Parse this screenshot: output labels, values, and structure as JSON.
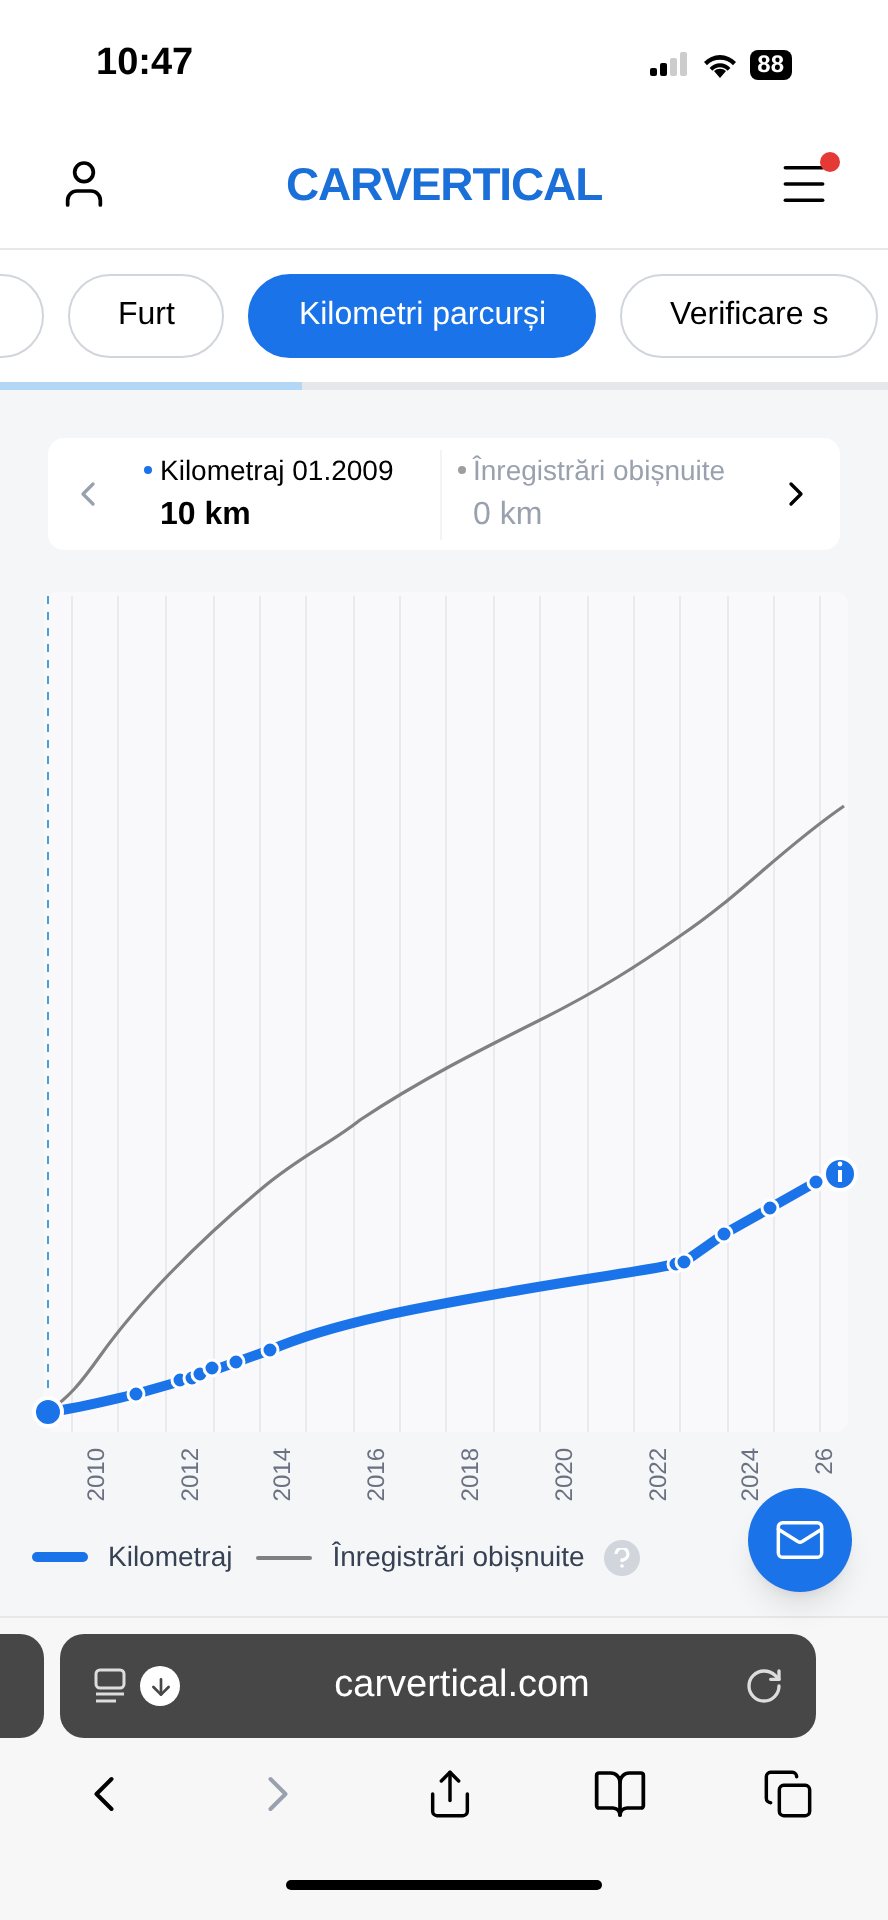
{
  "status_bar": {
    "time": "10:47",
    "battery": "88"
  },
  "header": {
    "logo": "CARVERTICAL",
    "notification": true
  },
  "tabs": [
    {
      "selected": false
    },
    {
      "label": "Furt",
      "selected": false
    },
    {
      "label": "Kilometri parcurși",
      "selected": true
    },
    {
      "label": "Verificare s",
      "selected": false
    }
  ],
  "tab_progress": {
    "level": 0.34
  },
  "info_card": {
    "items": [
      {
        "label": "Kilometraj 01.2009",
        "value": "10 km",
        "color": "#1a73e8",
        "muted": false
      },
      {
        "label": "Înregistrări obișnuite",
        "value": "0 km",
        "color": "#9e9e9e",
        "muted": true
      }
    ]
  },
  "chart": {
    "x_labels": [
      "2010",
      "2012",
      "2014",
      "2016",
      "2018",
      "2020",
      "2022",
      "2024",
      "26"
    ],
    "legend": [
      {
        "label": "Kilometraj",
        "kind": "thick",
        "color": "#1a73e8"
      },
      {
        "label": "Înregistrări obișnuite",
        "kind": "thin",
        "color": "#808080",
        "help": true
      }
    ]
  },
  "browser": {
    "url": "carvertical.com"
  }
}
